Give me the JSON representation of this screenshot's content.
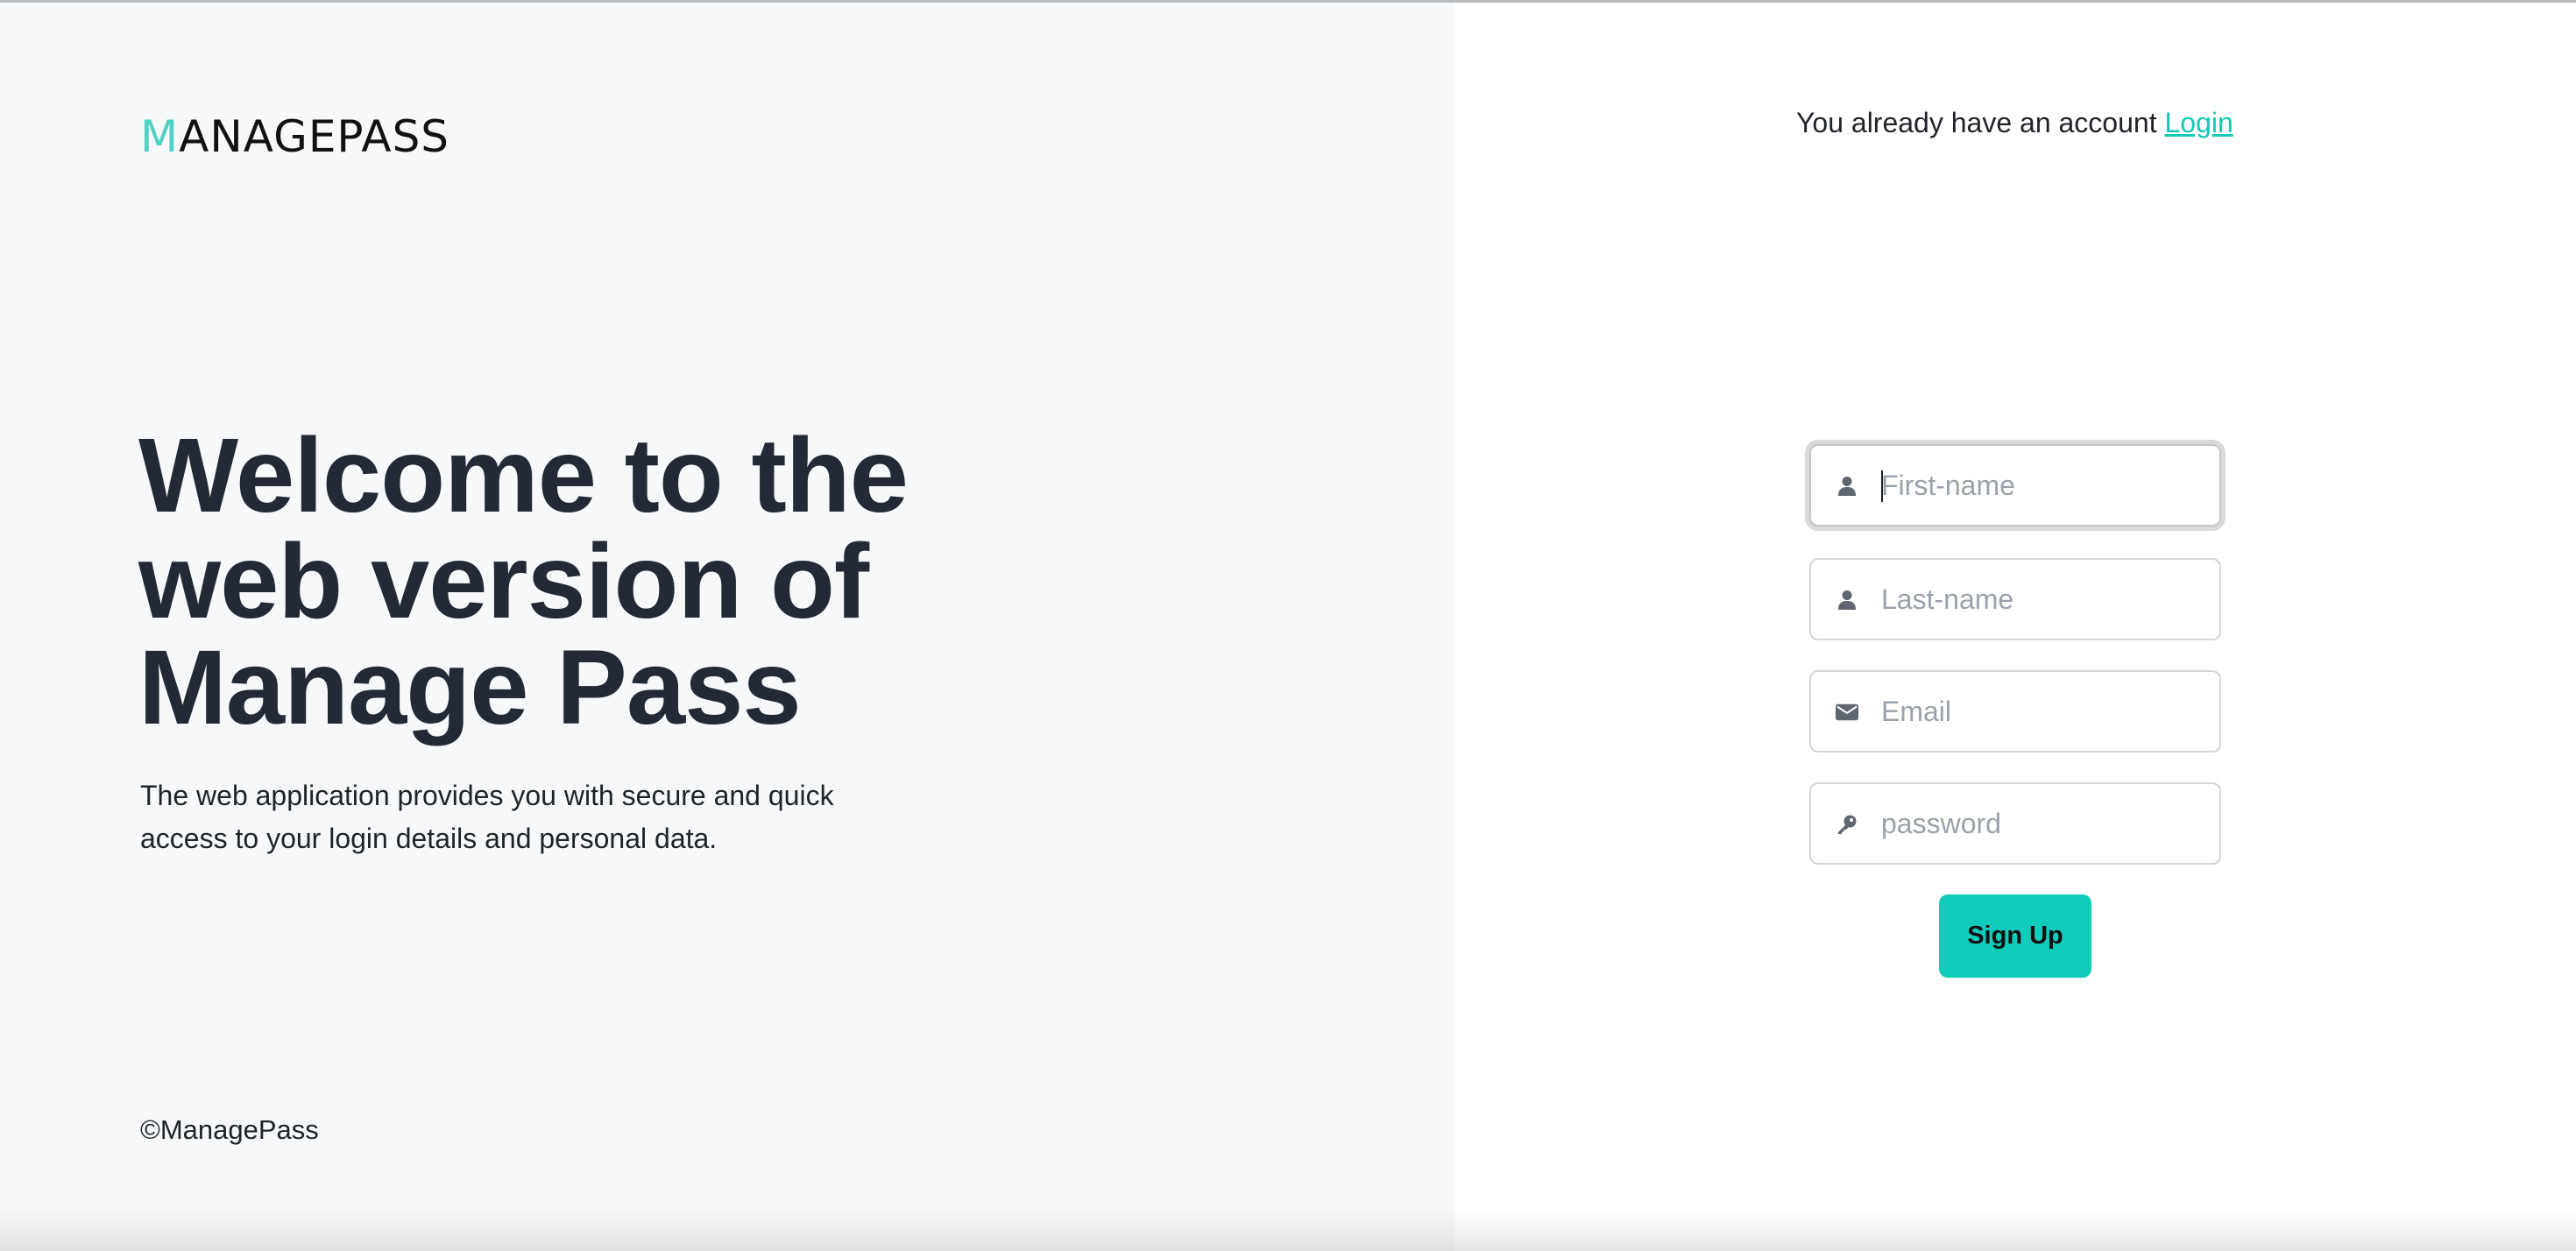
{
  "brand": {
    "logo_initial": "M",
    "logo_rest": "ANAGEPASS",
    "accent_color": "#4fd1c5",
    "button_color": "#12ccbb"
  },
  "hero": {
    "title_line1": "Welcome to the",
    "title_line2": "web version of",
    "title_line3": "Manage Pass",
    "description": "The web application provides you with secure and quick access to your login details and personal data."
  },
  "footer": {
    "copyright": "©ManagePass"
  },
  "account": {
    "prompt": "You already have an account",
    "login_label": "Login"
  },
  "form": {
    "first_name": {
      "placeholder": "First-name",
      "value": "",
      "icon": "user-icon"
    },
    "last_name": {
      "placeholder": "Last-name",
      "value": "",
      "icon": "user-icon"
    },
    "email": {
      "placeholder": "Email",
      "value": "",
      "icon": "envelope-icon"
    },
    "password": {
      "placeholder": "password",
      "value": "",
      "icon": "key-icon"
    },
    "submit_label": "Sign Up"
  }
}
